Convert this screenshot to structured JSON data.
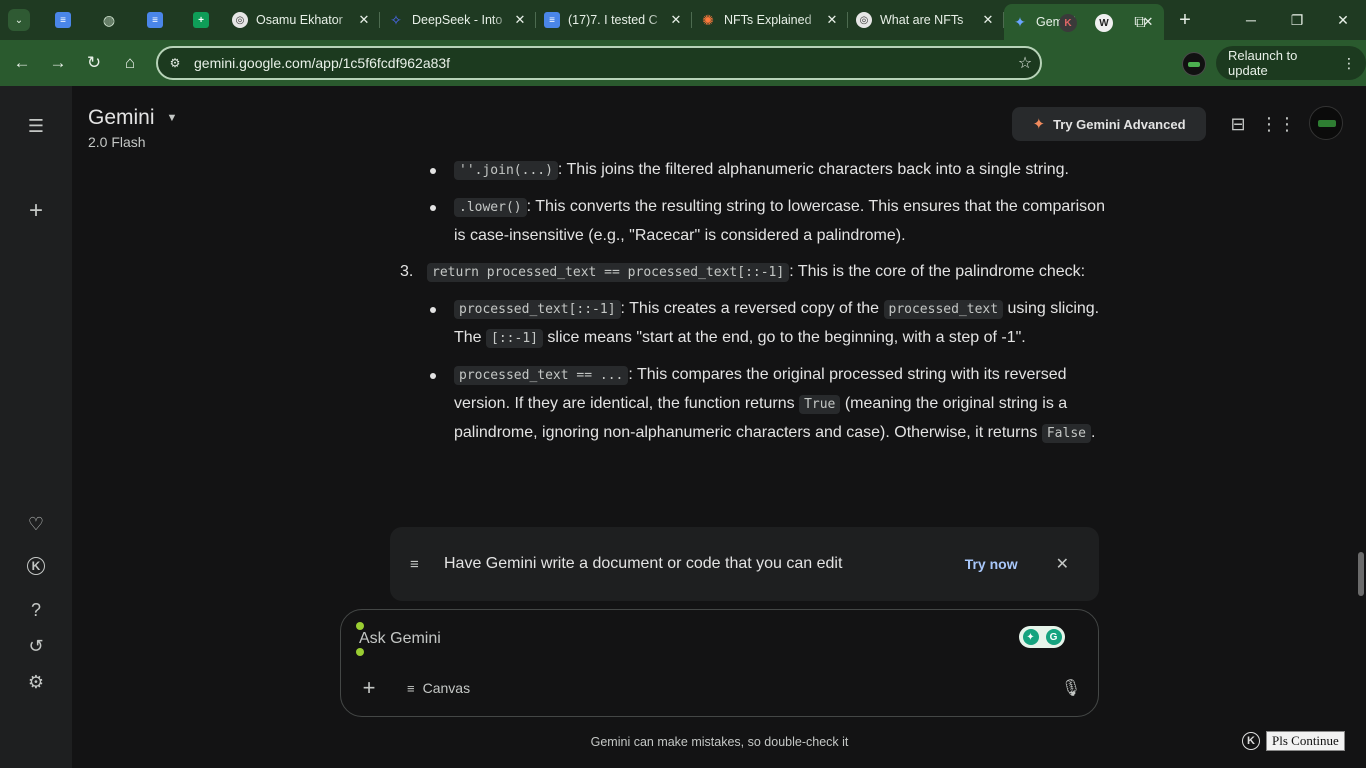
{
  "browser": {
    "tabs": [
      {
        "icon": "docs-icon",
        "title": "",
        "type": "doc"
      },
      {
        "icon": "globe-icon",
        "title": "",
        "type": "globe"
      },
      {
        "icon": "docs-icon",
        "title": "",
        "type": "doc"
      },
      {
        "icon": "sheets-icon",
        "title": "",
        "type": "sheet"
      },
      {
        "icon": "openai-icon",
        "title": "Osamu Ekhator",
        "type": "circ"
      },
      {
        "icon": "deepseek-icon",
        "title": "DeepSeek - Into",
        "type": "ds"
      },
      {
        "icon": "docs-icon",
        "title": "(17)7. I tested C",
        "type": "doc"
      },
      {
        "icon": "claude-icon",
        "title": "NFTs Explained",
        "type": "star"
      },
      {
        "icon": "openai-icon",
        "title": "What are NFTs",
        "type": "circ"
      },
      {
        "icon": "gemini-icon",
        "title": "Gemini",
        "type": "gem",
        "active": true
      }
    ],
    "url": "gemini.google.com/app/1c5f6fcdf962a83f",
    "relaunch_label": "Relaunch to update",
    "accent": "#2a5a2e"
  },
  "header": {
    "app_name": "Gemini",
    "model": "2.0 Flash",
    "try_advanced": "Try Gemini Advanced"
  },
  "content": {
    "b1_code": "''.join(...)",
    "b1_text": ": This joins the filtered alphanumeric characters back into a single string.",
    "b2_code": ".lower()",
    "b2_text": ": This converts the resulting string to lowercase. This ensures that the comparison is case-insensitive (e.g., \"Racecar\" is considered a palindrome).",
    "step3_num": "3.",
    "step3_code": "return processed_text == processed_text[::-1]",
    "step3_text": ": This is the core of the palindrome check:",
    "b3_code": "processed_text[::-1]",
    "b3_text_a": ": This creates a reversed copy of the ",
    "b3_code2": "processed_text",
    "b3_text_b": " using slicing. The ",
    "b3_code3": "[::-1]",
    "b3_text_c": " slice means \"start at the end, go to the beginning, with a step of -1\".",
    "b4_code": "processed_text == ...",
    "b4_text_a": ": This compares the original processed string with its reversed version. If they are identical, the function returns ",
    "b4_code2": "True",
    "b4_text_b": " (meaning the original string is a palindrome, ignoring non-alphanumeric characters and case). Otherwise, it returns ",
    "b4_code3": "False",
    "b4_text_c": "."
  },
  "canvas_banner": {
    "text": "Have Gemini write a document or code that you can edit",
    "try_now": "Try now"
  },
  "composer": {
    "placeholder": "Ask Gemini",
    "canvas_label": "Canvas"
  },
  "footer": {
    "disclaimer": "Gemini can make mistakes, so double-check it",
    "pls_continue": "Pls Continue"
  }
}
